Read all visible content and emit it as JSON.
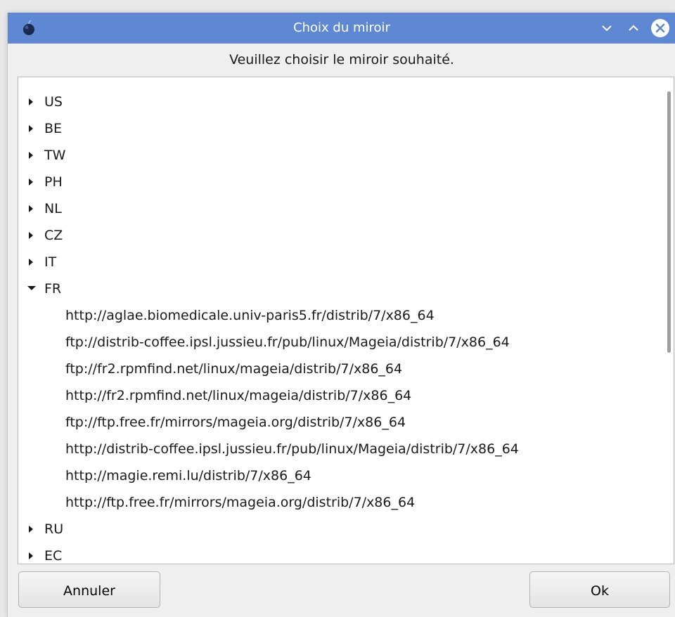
{
  "window": {
    "title": "Choix du miroir",
    "titlebar_color": "#5e88d4",
    "controls": [
      "minimize-icon",
      "maximize-icon",
      "close-icon"
    ]
  },
  "prompt": "Veuillez choisir le miroir souhaité.",
  "mirror_tree": {
    "countries_before": [
      "US",
      "BE",
      "TW",
      "PH",
      "NL",
      "CZ",
      "IT"
    ],
    "expanded_country": "FR",
    "expanded_urls": [
      "http://aglae.biomedicale.univ-paris5.fr/distrib/7/x86_64",
      "ftp://distrib-coffee.ipsl.jussieu.fr/pub/linux/Mageia/distrib/7/x86_64",
      "ftp://fr2.rpmfind.net/linux/mageia/distrib/7/x86_64",
      "http://fr2.rpmfind.net/linux/mageia/distrib/7/x86_64",
      "ftp://ftp.free.fr/mirrors/mageia.org/distrib/7/x86_64",
      "http://distrib-coffee.ipsl.jussieu.fr/pub/linux/Mageia/distrib/7/x86_64",
      "http://magie.remi.lu/distrib/7/x86_64",
      "http://ftp.free.fr/mirrors/mageia.org/distrib/7/x86_64"
    ],
    "countries_after": [
      "RU",
      "EC"
    ]
  },
  "buttons": {
    "cancel": "Annuler",
    "ok": "Ok"
  }
}
